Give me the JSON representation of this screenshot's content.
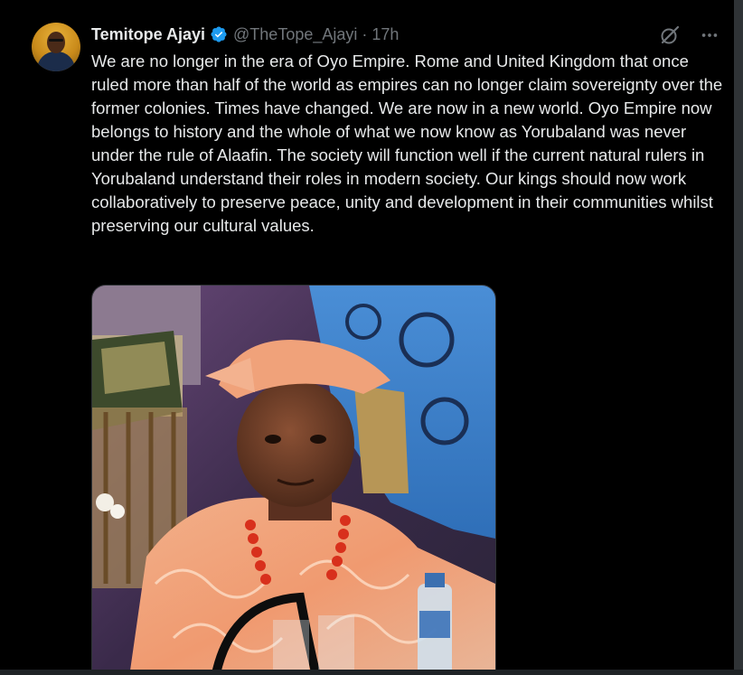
{
  "tweet": {
    "author_name": "Temitope Ajayi",
    "handle": "@TheTope_Ajayi",
    "separator": "·",
    "timestamp": "17h",
    "verified": true,
    "text": "We are no longer in the era of Oyo Empire. Rome and United Kingdom that once ruled more than half of the world as empires can no longer claim sovereignty over the former colonies. Times have changed. We are now in a new world. Oyo Empire now belongs to history and the whole of what we now know as Yorubaland was never under the rule of Alaafin. The society will function well if the current natural rulers in Yorubaland understand their roles in modern society. Our kings should now work collaboratively to preserve peace, unity and development in their communities whilst preserving our cultural values.",
    "icons": {
      "verified": "verified-badge-icon",
      "grok": "grok-icon",
      "more": "more-options-icon"
    }
  },
  "colors": {
    "background": "#000000",
    "text_primary": "#e7e9ea",
    "text_secondary": "#71767b",
    "verified_blue": "#1d9bf0",
    "border": "#2f3336"
  }
}
